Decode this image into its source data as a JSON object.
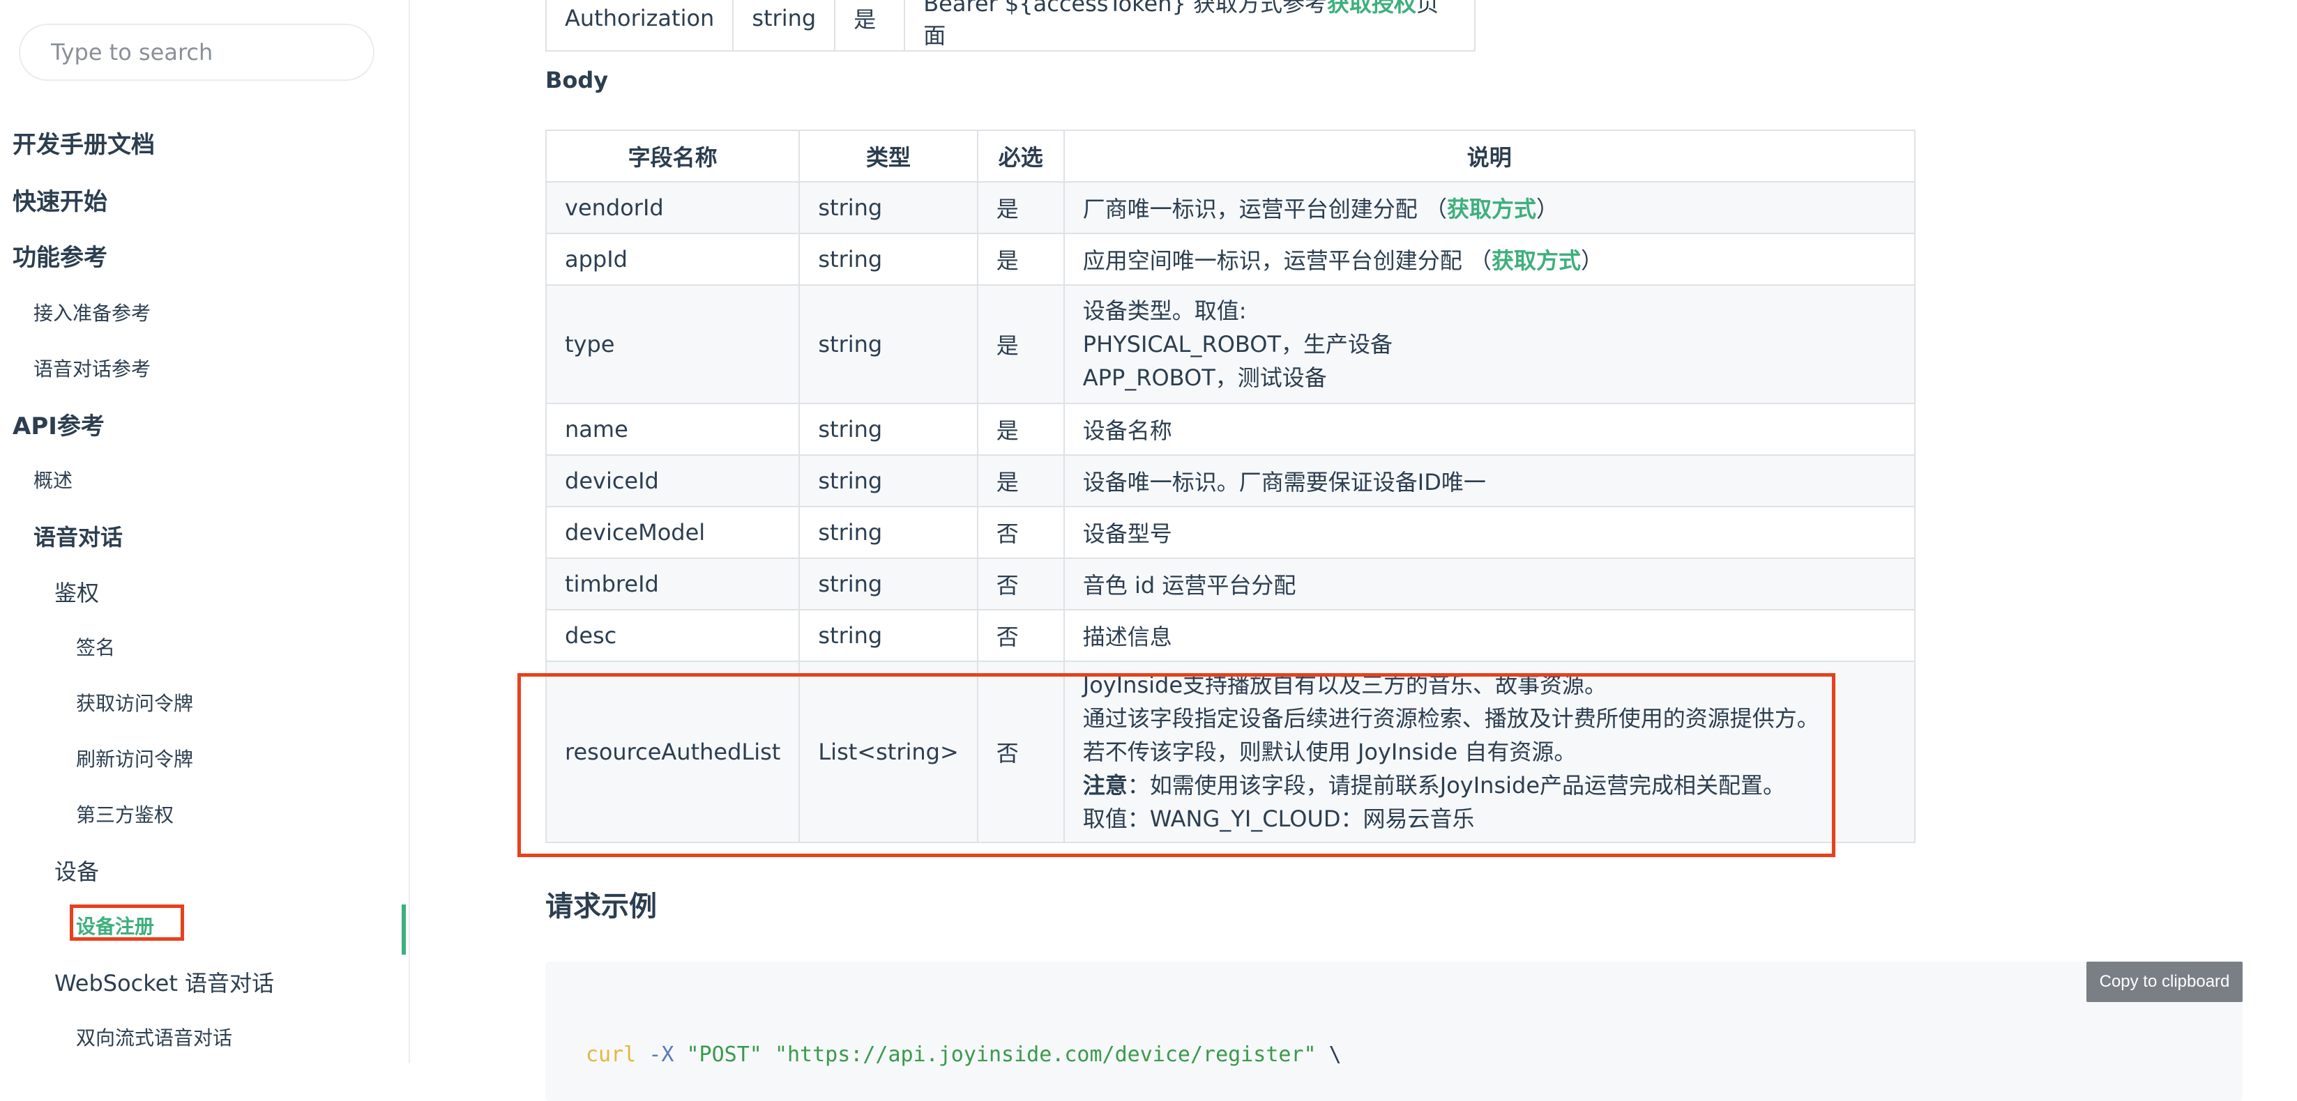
{
  "sidebar": {
    "search_placeholder": "Type to search",
    "items": [
      {
        "label": "开发手册文档"
      },
      {
        "label": "快速开始"
      },
      {
        "label": "功能参考"
      },
      {
        "label": "接入准备参考"
      },
      {
        "label": "语音对话参考"
      },
      {
        "label": "API参考"
      },
      {
        "label": "概述"
      },
      {
        "label": "语音对话"
      },
      {
        "label": "鉴权"
      },
      {
        "label": "签名"
      },
      {
        "label": "获取访问令牌"
      },
      {
        "label": "刷新访问令牌"
      },
      {
        "label": "第三方鉴权"
      },
      {
        "label": "设备"
      },
      {
        "label": "设备注册"
      },
      {
        "label": "WebSocket 语音对话"
      },
      {
        "label": "双向流式语音对话"
      }
    ],
    "active_item": "设备注册",
    "accent_color": "#3eaf7c"
  },
  "header_table": {
    "row": {
      "name": "Authorization",
      "type": "string",
      "required": "是",
      "desc_prefix": "Bearer ${accessToken} 获取方式参考",
      "desc_link": "获取授权",
      "desc_suffix": "页面"
    }
  },
  "body": {
    "label": "Body",
    "columns": [
      "字段名称",
      "类型",
      "必选",
      "说明"
    ],
    "rows": [
      {
        "name": "vendorId",
        "type": "string",
        "required": "是",
        "desc": "厂商唯一标识，运营平台创建分配 （",
        "link": "获取方式",
        "desc_end": "）"
      },
      {
        "name": "appId",
        "type": "string",
        "required": "是",
        "desc": "应用空间唯一标识，运营平台创建分配 （",
        "link": "获取方式",
        "desc_end": "）"
      },
      {
        "name": "type",
        "type": "string",
        "required": "是",
        "lines": [
          "设备类型。取值:",
          "PHYSICAL_ROBOT，生产设备",
          "APP_ROBOT，测试设备"
        ]
      },
      {
        "name": "name",
        "type": "string",
        "required": "是",
        "desc": "设备名称"
      },
      {
        "name": "deviceId",
        "type": "string",
        "required": "是",
        "desc": "设备唯一标识。厂商需要保证设备ID唯一"
      },
      {
        "name": "deviceModel",
        "type": "string",
        "required": "否",
        "desc": "设备型号"
      },
      {
        "name": "timbreId",
        "type": "string",
        "required": "否",
        "desc": "音色 id 运营平台分配"
      },
      {
        "name": "desc",
        "type": "string",
        "required": "否",
        "desc": "描述信息"
      },
      {
        "name": "resourceAuthedList",
        "type": "List<string>",
        "required": "否",
        "lines": [
          "JoyInside支持播放自有以及三方的音乐、故事资源。",
          "通过该字段指定设备后续进行资源检索、播放及计费所使用的资源提供方。",
          "若不传该字段，则默认使用 JoyInside 自有资源。"
        ],
        "note_label": "注意",
        "note_text": "：如需使用该字段，请提前联系JoyInside产品运营完成相关配置。",
        "value_line": "取值：WANG_YI_CLOUD：网易云音乐"
      }
    ]
  },
  "request_example": {
    "title": "请求示例",
    "copy_label": "Copy to clipboard",
    "code": {
      "cmd": "curl",
      "flag": "-X",
      "method": "\"POST\"",
      "url": "\"https://api.joyinside.com/device/register\"",
      "cont": "\\"
    }
  }
}
